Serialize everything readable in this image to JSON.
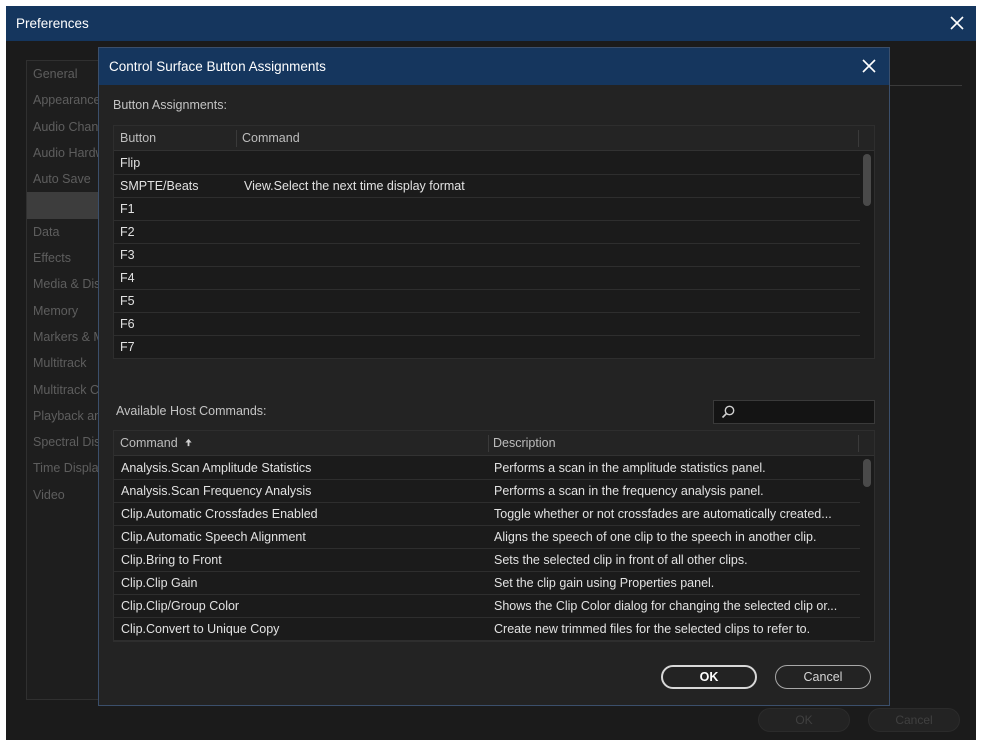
{
  "preferences": {
    "title": "Preferences",
    "close_icon": "close-icon",
    "sidebar_items": [
      {
        "label": "General"
      },
      {
        "label": "Appearance"
      },
      {
        "label": "Audio Channel Mapping"
      },
      {
        "label": "Audio Hardware"
      },
      {
        "label": "Auto Save"
      },
      {
        "label": ""
      },
      {
        "label": "Data"
      },
      {
        "label": "Effects"
      },
      {
        "label": "Media & Disk Cache"
      },
      {
        "label": "Memory"
      },
      {
        "label": "Markers & Metadata"
      },
      {
        "label": "Multitrack"
      },
      {
        "label": "Multitrack Clips"
      },
      {
        "label": "Playback and Recording"
      },
      {
        "label": "Spectral Displays"
      },
      {
        "label": "Time Display"
      },
      {
        "label": "Video"
      }
    ],
    "ok_label": "OK",
    "cancel_label": "Cancel"
  },
  "dialog": {
    "title": "Control Surface Button Assignments",
    "close_icon": "close-icon",
    "assignments_label": "Button Assignments:",
    "assignments_columns": [
      "Button",
      "Command"
    ],
    "assignments_rows": [
      [
        "Flip",
        ""
      ],
      [
        "SMPTE/Beats",
        "View.Select the next time display format"
      ],
      [
        "F1",
        ""
      ],
      [
        "F2",
        ""
      ],
      [
        "F3",
        ""
      ],
      [
        "F4",
        ""
      ],
      [
        "F5",
        ""
      ],
      [
        "F6",
        ""
      ],
      [
        "F7",
        ""
      ]
    ],
    "host_label": "Available Host Commands:",
    "search": {
      "icon": "search-icon",
      "placeholder": ""
    },
    "host_columns": [
      "Command",
      "Description"
    ],
    "sort_icon": "sort-ascending-icon",
    "host_rows": [
      [
        "Analysis.Scan Amplitude Statistics",
        "Performs a scan in the amplitude statistics panel."
      ],
      [
        "Analysis.Scan Frequency Analysis",
        "Performs a scan in the frequency analysis panel."
      ],
      [
        "Clip.Automatic Crossfades Enabled",
        "Toggle whether or not crossfades are automatically created..."
      ],
      [
        "Clip.Automatic Speech Alignment",
        "Aligns the speech of one clip to the speech in another clip."
      ],
      [
        "Clip.Bring to Front",
        "Sets the selected clip in front of all other clips."
      ],
      [
        "Clip.Clip Gain",
        "Set the clip gain using Properties panel."
      ],
      [
        "Clip.Clip/Group Color",
        "Shows the Clip Color dialog for changing the selected clip or..."
      ],
      [
        "Clip.Convert to Unique Copy",
        "Create new trimmed files for the selected clips to refer to."
      ]
    ],
    "ok_label": "OK",
    "cancel_label": "Cancel"
  }
}
